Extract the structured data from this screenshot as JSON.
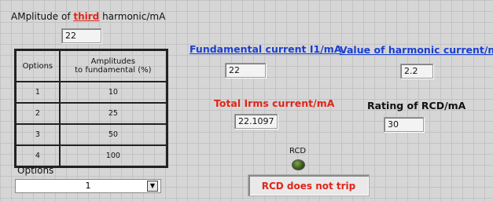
{
  "amplitude": {
    "label_prefix": "AMplitude of ",
    "label_highlight": "third",
    "label_suffix": " harmonic/mA",
    "value": "22"
  },
  "table": {
    "headers": [
      "Options",
      "Amplitudes\nto fundamental (%)"
    ],
    "rows": [
      [
        "1",
        "10"
      ],
      [
        "2",
        "25"
      ],
      [
        "3",
        "50"
      ],
      [
        "4",
        "100"
      ]
    ]
  },
  "options": {
    "label": "Options",
    "selected": "1"
  },
  "fundamental": {
    "label": "Fundamental current I1/mA",
    "value": "22"
  },
  "harmonic": {
    "label": "Value of harmonic current/mA",
    "value": "2.2"
  },
  "total": {
    "label": "Total Irms current/mA",
    "value": "22.1097"
  },
  "rating": {
    "label": "Rating of RCD/mA",
    "value": "30"
  },
  "rcd": {
    "label": "RCD",
    "status": "RCD does not trip",
    "led_color": "#3c5b1f"
  },
  "colors": {
    "accent_blue": "#1a3fd0",
    "accent_red": "#e0251b"
  }
}
